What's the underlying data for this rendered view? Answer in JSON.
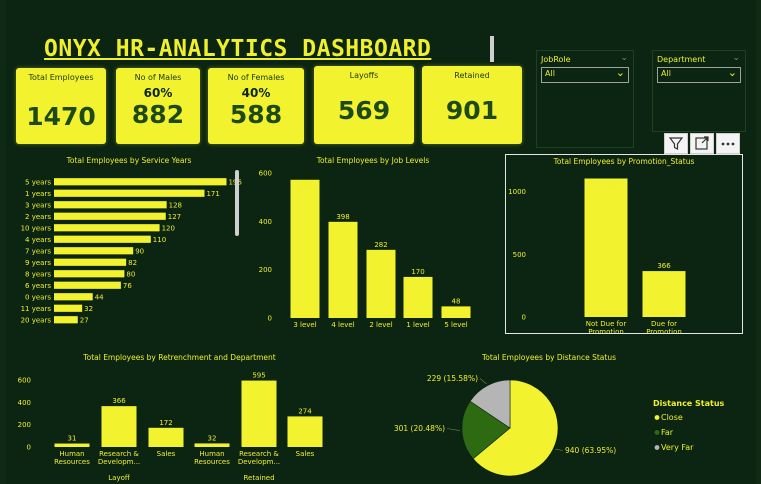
{
  "dashboard": {
    "title": "ONYX HR-ANALYTICS DASHBOARD"
  },
  "kpis": {
    "total": {
      "label": "Total Employees",
      "value": "1470"
    },
    "males": {
      "label": "No of Males",
      "pct": "60%",
      "value": "882"
    },
    "females": {
      "label": "No of Females",
      "pct": "40%",
      "value": "588"
    },
    "layoffs": {
      "label": "Layoffs",
      "value": "569"
    },
    "retained": {
      "label": "Retained",
      "value": "901"
    }
  },
  "slicers": {
    "jobrole": {
      "label": "JobRole",
      "value": "All"
    },
    "department": {
      "label": "Department",
      "value": "All"
    }
  },
  "toolbar": {
    "icons": [
      "filter-icon",
      "expand-icon",
      "more-options-icon"
    ]
  },
  "colors": {
    "accent": "#f0f02a",
    "background": "#0b2512",
    "bar": "#f2f22f",
    "dark_green": "#2d6a12",
    "grey": "#b5b5b5"
  },
  "chart_data": [
    {
      "id": "service",
      "type": "bar",
      "orientation": "horizontal",
      "title": "Total Employees by Service Years",
      "categories": [
        "5 years",
        "1 years",
        "3 years",
        "2 years",
        "10 years",
        "4 years",
        "7 years",
        "9 years",
        "8 years",
        "6 years",
        "0 years",
        "11 years",
        "20 years"
      ],
      "values": [
        196,
        171,
        128,
        127,
        120,
        110,
        90,
        82,
        80,
        76,
        44,
        32,
        27
      ],
      "value_labels": [
        "196",
        "171",
        "128",
        "127",
        "120",
        "110",
        "90",
        "82",
        "80",
        "76",
        "44",
        "32",
        "27"
      ],
      "xticks": [
        "0",
        "50",
        "100",
        "150",
        "200"
      ],
      "xlim": [
        0,
        200
      ]
    },
    {
      "id": "joblevels",
      "type": "bar",
      "title": "Total Employees by Job Levels",
      "categories": [
        "3 level",
        "4 level",
        "2 level",
        "1 level",
        "5 level"
      ],
      "values": [
        572,
        398,
        282,
        170,
        48
      ],
      "value_labels": [
        "572",
        "398",
        "282",
        "170",
        "48"
      ],
      "yticks": [
        "0",
        "200",
        "400",
        "600"
      ],
      "ylim": [
        0,
        600
      ]
    },
    {
      "id": "promotion",
      "type": "bar",
      "title": "Total Employees by Promotion_Status",
      "categories": [
        [
          "Not Due for",
          "Promotion"
        ],
        [
          "Due for",
          "Promotion"
        ]
      ],
      "values": [
        1104,
        366
      ],
      "value_labels": [
        "1104",
        "366"
      ],
      "yticks": [
        "0",
        "500",
        "1000"
      ],
      "ylim": [
        0,
        1100
      ]
    },
    {
      "id": "retrenchment",
      "type": "bar",
      "title": "Total Employees by Retrenchment and Department",
      "categories": [
        [
          "Human",
          "Resources"
        ],
        [
          "Research &",
          "Developm..."
        ],
        [
          "Sales"
        ],
        [
          "Human",
          "Resources"
        ],
        [
          "Research &",
          "Developm..."
        ],
        [
          "Sales"
        ]
      ],
      "groups": [
        "Layoff",
        "Retained"
      ],
      "values": [
        31,
        366,
        172,
        32,
        595,
        274
      ],
      "value_labels": [
        "31",
        "366",
        "172",
        "32",
        "595",
        "274"
      ],
      "yticks": [
        "0",
        "200",
        "400",
        "600"
      ],
      "ylim": [
        0,
        600
      ]
    },
    {
      "id": "distance",
      "type": "pie",
      "title": "Total Employees by Distance Status",
      "slices": [
        {
          "name": "Close",
          "value": 940,
          "label": "940 (63.95%)",
          "color": "#f2f22f"
        },
        {
          "name": "Far",
          "value": 301,
          "label": "301 (20.48%)",
          "color": "#2d6a12"
        },
        {
          "name": "Very Far",
          "value": 229,
          "label": "229 (15.58%)",
          "color": "#b5b5b5"
        }
      ],
      "legend_title": "Distance Status",
      "legend_position": "right"
    }
  ]
}
